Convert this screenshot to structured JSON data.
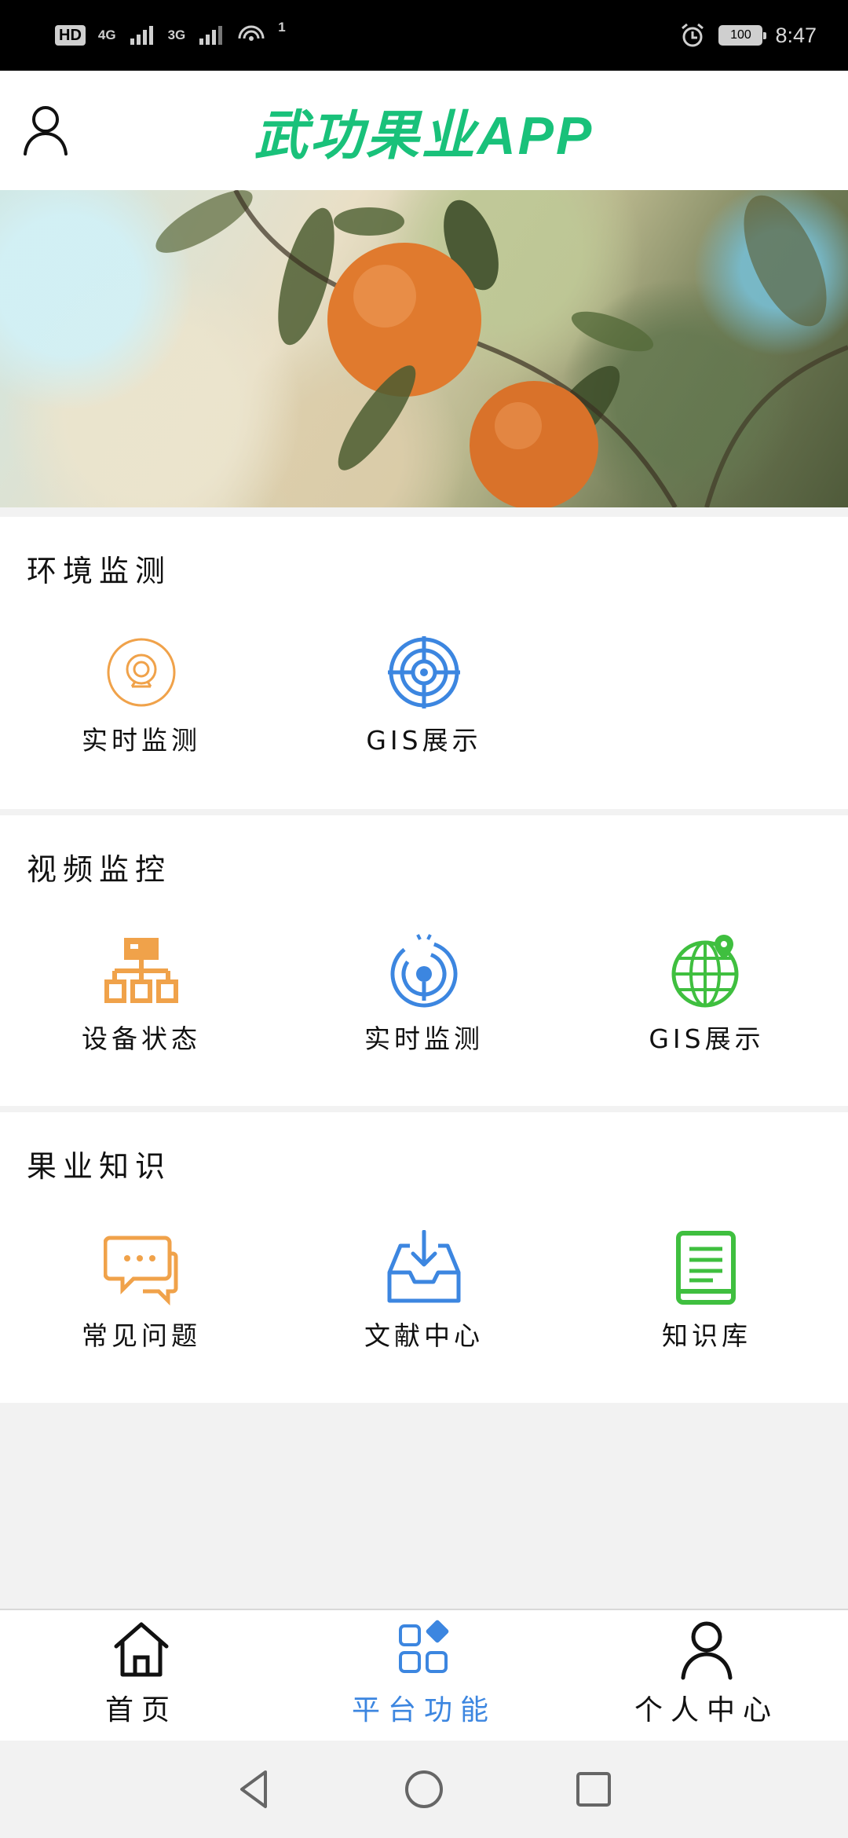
{
  "status_bar": {
    "left_badges": [
      "HD",
      "4G",
      "3G"
    ],
    "notification_count": "1",
    "battery": "100",
    "time": "8:47"
  },
  "header": {
    "title": "武功果业APP",
    "title_color": "#19c17a",
    "left_icon": "user-icon"
  },
  "sections": [
    {
      "title": "环境监测",
      "items": [
        {
          "label": "实时监测",
          "icon": "camera-icon",
          "color": "#f0a24a"
        },
        {
          "label": "GIS展示",
          "icon": "target-icon",
          "color": "#3c86e0"
        }
      ]
    },
    {
      "title": "视频监控",
      "items": [
        {
          "label": "设备状态",
          "icon": "hierarchy-icon",
          "color": "#f0a24a"
        },
        {
          "label": "实时监测",
          "icon": "broadcast-icon",
          "color": "#3c86e0"
        },
        {
          "label": "GIS展示",
          "icon": "globe-pin-icon",
          "color": "#3fbf3f"
        }
      ]
    },
    {
      "title": "果业知识",
      "items": [
        {
          "label": "常见问题",
          "icon": "chat-icon",
          "color": "#f0a24a"
        },
        {
          "label": "文献中心",
          "icon": "inbox-download-icon",
          "color": "#3c86e0"
        },
        {
          "label": "知识库",
          "icon": "book-icon",
          "color": "#3fbf3f"
        }
      ]
    }
  ],
  "tabbar": {
    "items": [
      {
        "label": "首页",
        "icon": "home-icon",
        "active": false
      },
      {
        "label": "平台功能",
        "icon": "apps-icon",
        "active": true
      },
      {
        "label": "个人中心",
        "icon": "person-icon",
        "active": false
      }
    ],
    "active_color": "#3c86e0"
  }
}
